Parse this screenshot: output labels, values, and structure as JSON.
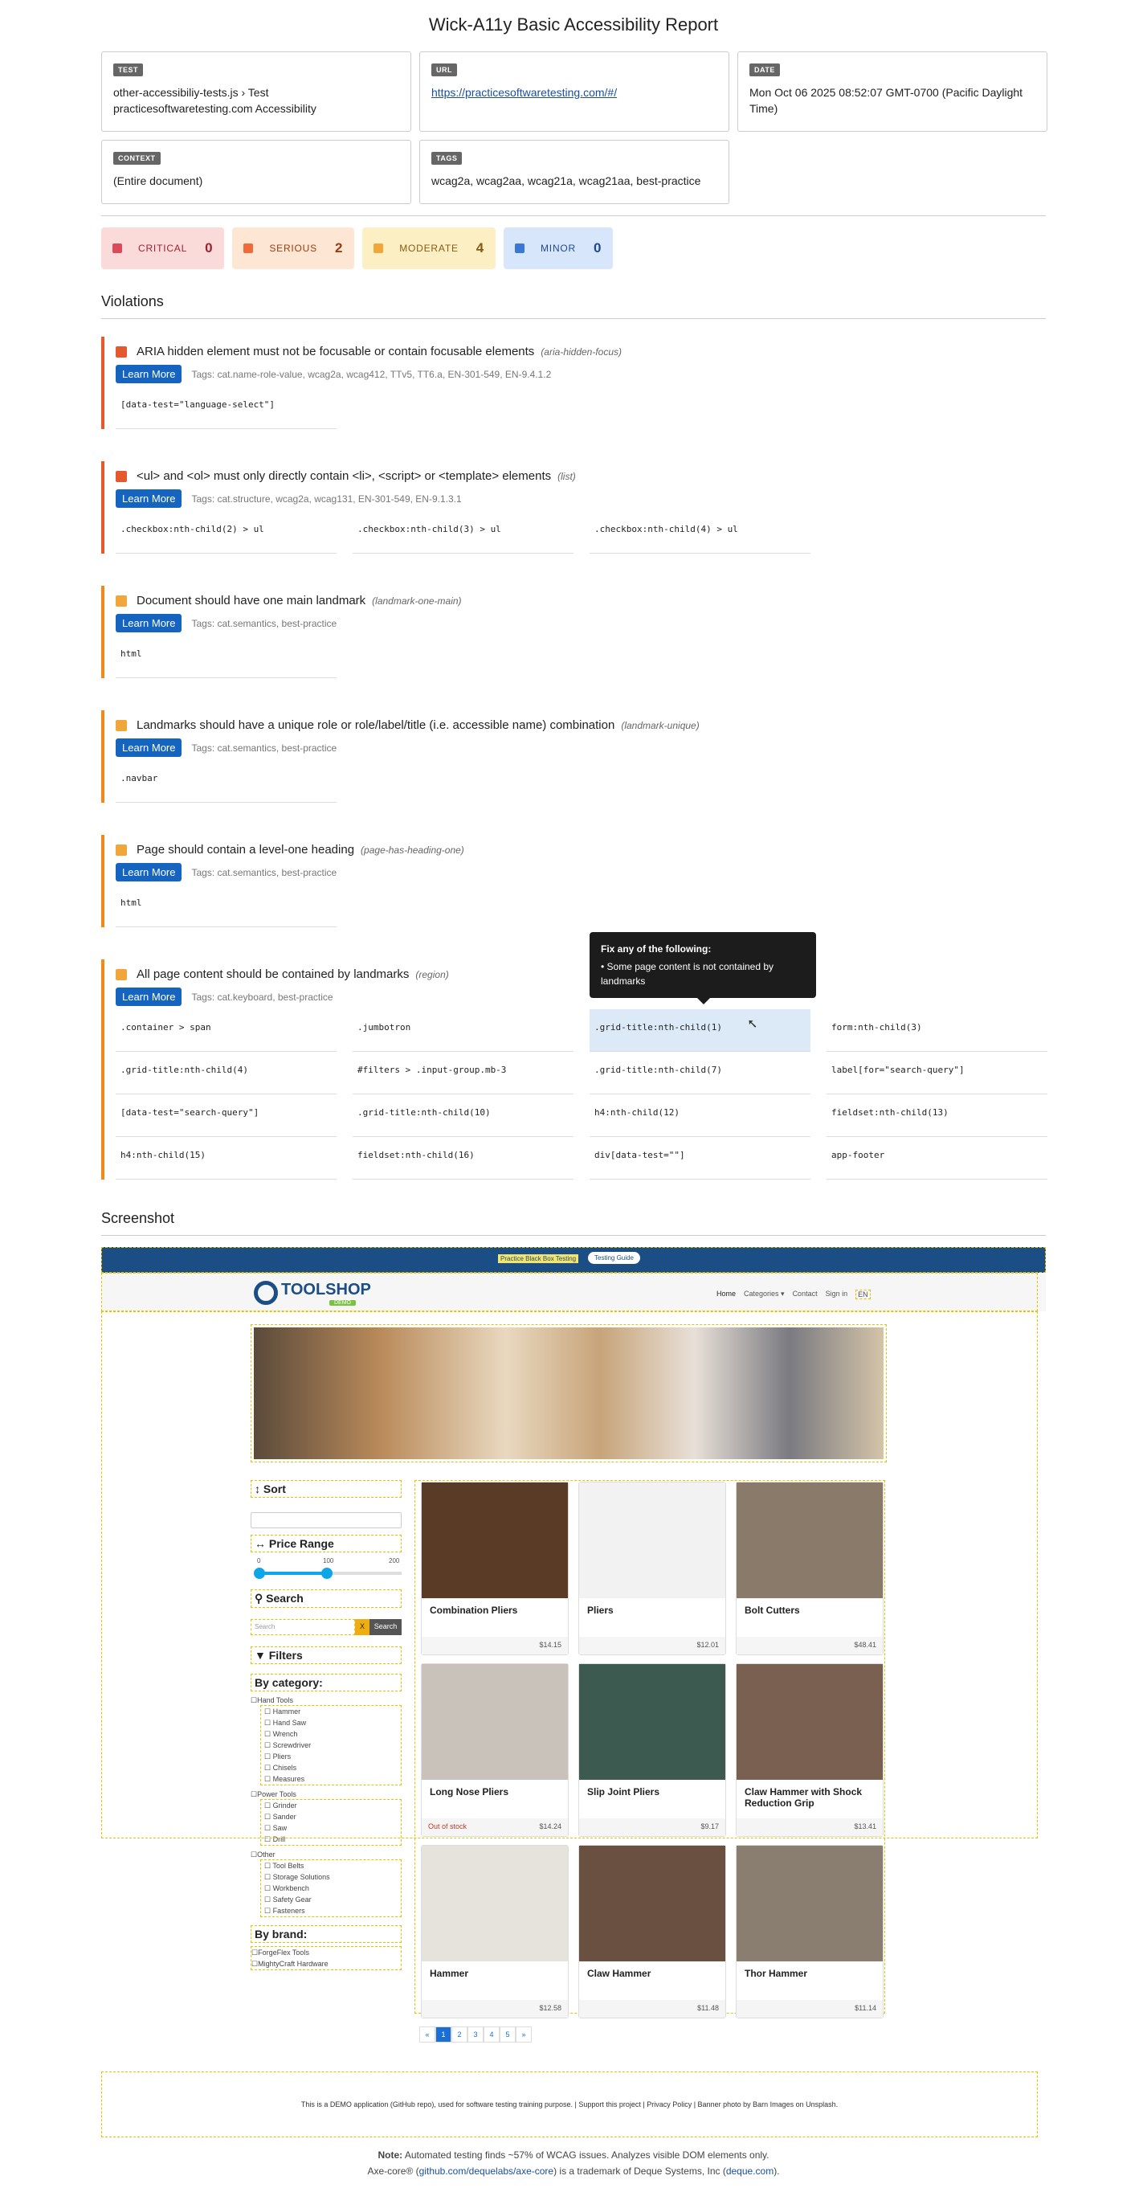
{
  "report": {
    "title": "Wick-A11y Basic Accessibility Report",
    "cards": {
      "test_label": "TEST",
      "test_value": "other-accessibiliy-tests.js › Test practicesoftwaretesting.com Accessibility",
      "url_label": "URL",
      "url_value": "https://practicesoftwaretesting.com/#/",
      "date_label": "DATE",
      "date_value": "Mon Oct 06 2025 08:52:07 GMT-0700 (Pacific Daylight Time)",
      "context_label": "CONTEXT",
      "context_value": "(Entire document)",
      "tags_label": "TAGS",
      "tags_value": "wcag2a, wcag2aa, wcag21a, wcag21aa, best-practice"
    },
    "severity": [
      {
        "label": "CRITICAL",
        "count": "0",
        "bg": "#fbdada",
        "dot": "#d94b5c",
        "fg": "#9c2230"
      },
      {
        "label": "SERIOUS",
        "count": "2",
        "bg": "#fde6d3",
        "dot": "#f06a3a",
        "fg": "#9a3c12"
      },
      {
        "label": "MODERATE",
        "count": "4",
        "bg": "#fdefc4",
        "dot": "#f0a63a",
        "fg": "#8a5a10"
      },
      {
        "label": "MINOR",
        "count": "0",
        "bg": "#d7e6fa",
        "dot": "#3b78d6",
        "fg": "#1f4a8e"
      }
    ],
    "violations_heading": "Violations",
    "learn_more": "Learn More",
    "violations": [
      {
        "title": "ARIA hidden element must not be focusable or contain focusable elements",
        "id": "(aria-hidden-focus)",
        "tags": "Tags: cat.name-role-value, wcag2a, wcag412, TTv5, TT6.a, EN-301-549, EN-9.4.1.2",
        "selectors": [
          "[data-test=\"language-select\"]"
        ]
      },
      {
        "title": "<ul> and <ol> must only directly contain <li>, <script> or <template> elements",
        "id": "(list)",
        "tags": "Tags: cat.structure, wcag2a, wcag131, EN-301-549, EN-9.1.3.1",
        "selectors": [
          ".checkbox:nth-child(2) > ul",
          ".checkbox:nth-child(3) > ul",
          ".checkbox:nth-child(4) > ul"
        ]
      },
      {
        "title": "Document should have one main landmark",
        "id": "(landmark-one-main)",
        "tags": "Tags: cat.semantics, best-practice",
        "selectors": [
          "html"
        ]
      },
      {
        "title": "Landmarks should have a unique role or role/label/title (i.e. accessible name) combination",
        "id": "(landmark-unique)",
        "tags": "Tags: cat.semantics, best-practice",
        "selectors": [
          ".navbar"
        ]
      },
      {
        "title": "Page should contain a level-one heading",
        "id": "(page-has-heading-one)",
        "tags": "Tags: cat.semantics, best-practice",
        "selectors": [
          "html"
        ]
      },
      {
        "title": "All page content should be contained by landmarks",
        "id": "(region)",
        "tags": "Tags: cat.keyboard, best-practice",
        "selectors": [
          ".container > span",
          ".jumbotron",
          ".grid-title:nth-child(1)",
          "form:nth-child(3)",
          ".grid-title:nth-child(4)",
          "#filters > .input-group.mb-3",
          ".grid-title:nth-child(7)",
          "label[for=\"search-query\"]",
          "[data-test=\"search-query\"]",
          ".grid-title:nth-child(10)",
          "h4:nth-child(12)",
          "fieldset:nth-child(13)",
          "h4:nth-child(15)",
          "fieldset:nth-child(16)",
          "div[data-test=\"\"]",
          "app-footer"
        ]
      }
    ],
    "tooltip": {
      "title": "Fix any of the following:",
      "body": "• Some page content is not contained by landmarks"
    },
    "screenshot_heading": "Screenshot",
    "note_bold": "Note:",
    "note_text": " Automated testing finds ~57% of WCAG issues. Analyzes visible DOM elements only.",
    "axe_pre": "Axe-core® (",
    "axe_link": "github.com/dequelabs/axe-core",
    "axe_mid": ") is a trademark of Deque Systems, Inc (",
    "axe_link2": "deque.com",
    "axe_post": ")."
  },
  "site": {
    "banner": "Practice Black Box Testing",
    "banner_btn": "Testing Guide",
    "logo": "TOOLSHOP",
    "logo_sub": "DEMO",
    "nav": [
      "Home",
      "Categories ▾",
      "Contact",
      "Sign in",
      "EN"
    ],
    "sort": "Sort",
    "price_range": "Price Range",
    "price_min": "0",
    "price_mid": "100",
    "price_max": "200",
    "search": "Search",
    "search_placeholder": "Search",
    "search_x": "X",
    "search_btn": "Search",
    "filters": "Filters",
    "by_category": "By category:",
    "hand_tools": "Hand Tools",
    "hand_items": [
      "Hammer",
      "Hand Saw",
      "Wrench",
      "Screwdriver",
      "Pliers",
      "Chisels",
      "Measures"
    ],
    "power_tools": "Power Tools",
    "power_items": [
      "Grinder",
      "Sander",
      "Saw",
      "Drill"
    ],
    "other": "Other",
    "other_items": [
      "Tool Belts",
      "Storage Solutions",
      "Workbench",
      "Safety Gear",
      "Fasteners"
    ],
    "by_brand": "By brand:",
    "brands": [
      "ForgeFlex Tools",
      "MightyCraft Hardware"
    ],
    "products": [
      {
        "name": "Combination Pliers",
        "price": "$14.15",
        "stock": ""
      },
      {
        "name": "Pliers",
        "price": "$12.01",
        "stock": ""
      },
      {
        "name": "Bolt Cutters",
        "price": "$48.41",
        "stock": ""
      },
      {
        "name": "Long Nose Pliers",
        "price": "$14.24",
        "stock": "Out of stock"
      },
      {
        "name": "Slip Joint Pliers",
        "price": "$9.17",
        "stock": ""
      },
      {
        "name": "Claw Hammer with Shock Reduction Grip",
        "price": "$13.41",
        "stock": ""
      },
      {
        "name": "Hammer",
        "price": "$12.58",
        "stock": ""
      },
      {
        "name": "Claw Hammer",
        "price": "$11.48",
        "stock": ""
      },
      {
        "name": "Thor Hammer",
        "price": "$11.14",
        "stock": ""
      }
    ],
    "pages": [
      "«",
      "1",
      "2",
      "3",
      "4",
      "5",
      "»"
    ],
    "footer": "This is a DEMO application (GitHub repo), used for software testing training purpose. | Support this project | Privacy Policy | Banner photo by Barn Images on Unsplash."
  }
}
